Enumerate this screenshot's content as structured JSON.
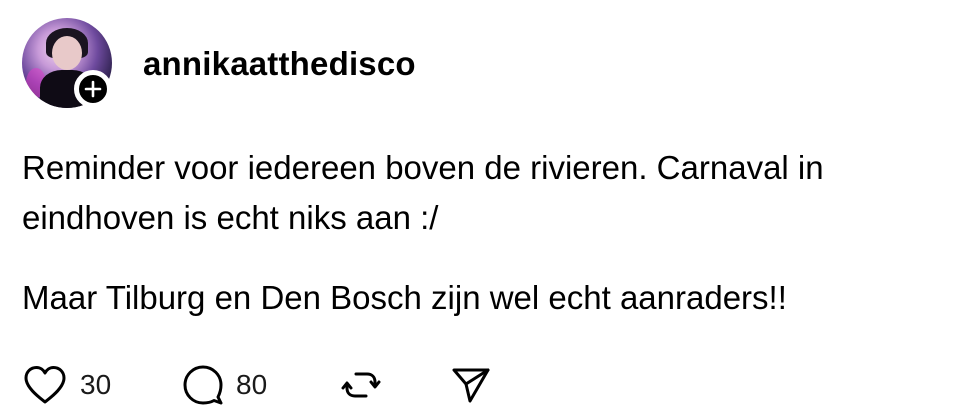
{
  "post": {
    "username": "annikaatthedisco",
    "text_line1": "Reminder voor iedereen boven de rivieren. Carnaval in",
    "text_line2": "eindhoven is echt niks aan :/",
    "text_line3": "Maar Tilburg en Den Bosch zijn wel echt aanraders!!"
  },
  "actions": {
    "like_count": "30",
    "comment_count": "80",
    "like_icon": "heart-icon",
    "comment_icon": "speech-bubble-icon",
    "repost_icon": "repost-icon",
    "share_icon": "send-icon"
  },
  "colors": {
    "text": "#000000",
    "background": "#ffffff"
  }
}
